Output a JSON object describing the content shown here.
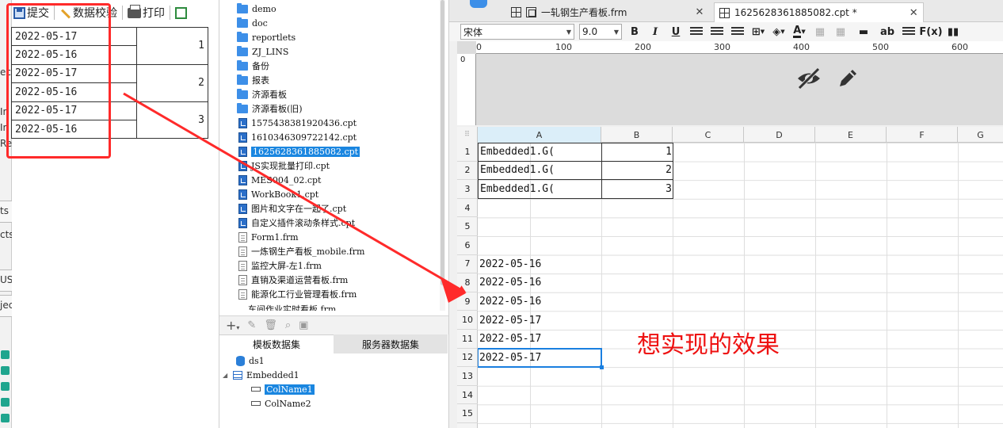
{
  "preview": {
    "strip_fragments": [
      "ect",
      "In",
      "In",
      "Re",
      "ts",
      "cts",
      "US",
      "jec"
    ],
    "toolbar": {
      "submit": "提交",
      "validate": "数据校验",
      "print": "打印"
    },
    "rows": [
      {
        "date": "2022-05-17"
      },
      {
        "date": "2022-05-16"
      },
      {
        "date": "2022-05-17"
      },
      {
        "date": "2022-05-16"
      },
      {
        "date": "2022-05-17"
      },
      {
        "date": "2022-05-16"
      }
    ],
    "groups": [
      "1",
      "2",
      "3"
    ]
  },
  "file_tree": {
    "items": [
      {
        "label": "demo",
        "type": "folder"
      },
      {
        "label": "doc",
        "type": "folder"
      },
      {
        "label": "reportlets",
        "type": "folder"
      },
      {
        "label": "ZJ_LINS",
        "type": "folder"
      },
      {
        "label": "备份",
        "type": "folder"
      },
      {
        "label": "报表",
        "type": "folder"
      },
      {
        "label": "济源看板",
        "type": "folder"
      },
      {
        "label": "济源看板(旧)",
        "type": "folder"
      },
      {
        "label": "1575438381920436.cpt",
        "type": "cpt"
      },
      {
        "label": "1610346309722142.cpt",
        "type": "cpt"
      },
      {
        "label": "1625628361885082.cpt",
        "type": "cpt",
        "selected": true
      },
      {
        "label": "JS实现批量打印.cpt",
        "type": "cpt"
      },
      {
        "label": "MES004_02.cpt",
        "type": "cpt"
      },
      {
        "label": "WorkBook1.cpt",
        "type": "cpt"
      },
      {
        "label": "图片和文字在一起了.cpt",
        "type": "cpt"
      },
      {
        "label": "自定义插件滚动条样式.cpt",
        "type": "cpt"
      },
      {
        "label": "Form1.frm",
        "type": "frm"
      },
      {
        "label": "一炼钢生产看板_mobile.frm",
        "type": "frm"
      },
      {
        "label": "监控大屏-左1.frm",
        "type": "frm"
      },
      {
        "label": "直销及渠道运营看板.frm",
        "type": "frm"
      },
      {
        "label": "能源化工行业管理看板.frm",
        "type": "frm"
      }
    ],
    "tail": "车间作业实时看板.frm"
  },
  "dataset": {
    "tabs": {
      "template": "模板数据集",
      "server": "服务器数据集"
    },
    "ds1": "ds1",
    "embedded": "Embedded1",
    "columns": [
      "ColName1",
      "ColName2"
    ]
  },
  "editor": {
    "tabs": [
      {
        "label": "一轧钢生产看板.frm"
      },
      {
        "label": "1625628361885082.cpt *"
      }
    ],
    "font_name": "宋体",
    "font_size": "9.0",
    "fmt_labels": {
      "bold": "B",
      "italic": "I",
      "underline": "U",
      "ab": "ab",
      "fx": "F(x)"
    },
    "ruler": {
      "zero": "0",
      "marks": [
        "100",
        "200",
        "300",
        "400",
        "500",
        "600"
      ]
    },
    "columns": [
      "A",
      "B",
      "C",
      "D",
      "E",
      "F",
      "G"
    ],
    "rows": [
      "1",
      "2",
      "3",
      "4",
      "5",
      "6",
      "7",
      "8",
      "9",
      "10",
      "11",
      "12",
      "13",
      "14",
      "15"
    ],
    "bound_rows": [
      {
        "a": "Embedded1.G(",
        "b": "1"
      },
      {
        "a": "Embedded1.G(",
        "b": "2"
      },
      {
        "a": "Embedded1.G(",
        "b": "3"
      }
    ],
    "dates": [
      "2022-05-16",
      "2022-05-16",
      "2022-05-16",
      "2022-05-17",
      "2022-05-17",
      "2022-05-17"
    ]
  },
  "annotation": "想实现的效果",
  "colors": {
    "accent": "#1a86e0",
    "annotation": "#ee1111",
    "frame": "#ff2a2a"
  }
}
